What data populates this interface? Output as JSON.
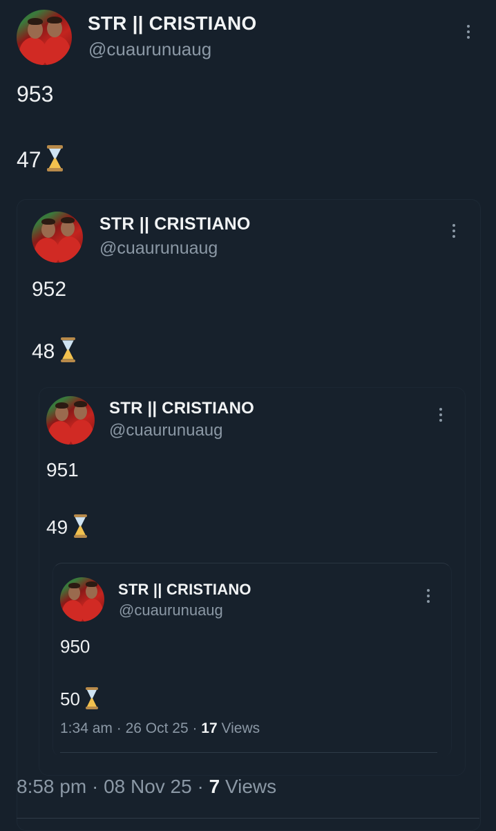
{
  "tweets": [
    {
      "display_name": "STR || CRISTIANO",
      "handle": "@cuaurunuaug",
      "line1": "953",
      "line2": "47",
      "line2_icon": "hourglass-icon"
    },
    {
      "display_name": "STR || CRISTIANO",
      "handle": "@cuaurunuaug",
      "line1": "952",
      "line2": "48",
      "line2_icon": "hourglass-icon"
    },
    {
      "display_name": "STR || CRISTIANO",
      "handle": "@cuaurunuaug",
      "line1": "951",
      "line2": "49",
      "line2_icon": "hourglass-icon"
    },
    {
      "display_name": "STR || CRISTIANO",
      "handle": "@cuaurunuaug",
      "line1": "950",
      "line2": "50",
      "line2_icon": "hourglass-icon",
      "time": "1:34 am",
      "date": "26 Oct 25",
      "views_count": "17",
      "views_label": "Views"
    }
  ],
  "main_meta": {
    "time": "8:58 pm",
    "date": "08 Nov 25",
    "views_count": "7",
    "views_label": "Views"
  }
}
